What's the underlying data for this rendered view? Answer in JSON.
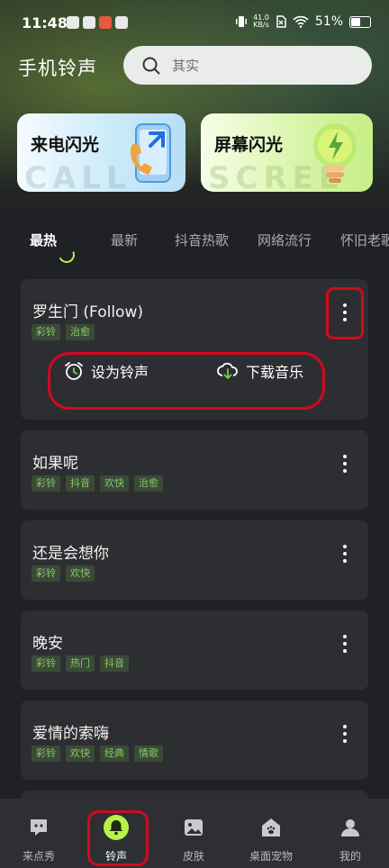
{
  "status_bar": {
    "time": "11:48",
    "net_speed_value": "41.0",
    "net_speed_unit": "KB/s",
    "battery": "51%"
  },
  "header": {
    "title": "手机铃声",
    "search_placeholder": "其实"
  },
  "banners": [
    {
      "label": "来电闪光",
      "ghost_text": "CALL"
    },
    {
      "label": "屏幕闪光",
      "ghost_text": "SCREE"
    }
  ],
  "tabs": [
    "最热",
    "最新",
    "抖音热歌",
    "网络流行",
    "怀旧老歌"
  ],
  "songs": [
    {
      "title": "罗生门 (Follow)",
      "tags": [
        "彩铃",
        "治愈"
      ]
    },
    {
      "title": "如果呢",
      "tags": [
        "彩铃",
        "抖音",
        "欢快",
        "治愈"
      ]
    },
    {
      "title": "还是会想你",
      "tags": [
        "彩铃",
        "欢快"
      ]
    },
    {
      "title": "晚安",
      "tags": [
        "彩铃",
        "热门",
        "抖音"
      ]
    },
    {
      "title": "爱情的索嗨",
      "tags": [
        "彩铃",
        "欢快",
        "经典",
        "情歌"
      ]
    }
  ],
  "song_actions": {
    "set_ringtone": "设为铃声",
    "download": "下载音乐"
  },
  "bottom_nav": [
    "来点秀",
    "铃声",
    "皮肤",
    "桌面宠物",
    "我的"
  ],
  "colors": {
    "accent_green": "#b8f24a",
    "tag_text": "#86c96a",
    "highlight_red": "#d3091d"
  }
}
